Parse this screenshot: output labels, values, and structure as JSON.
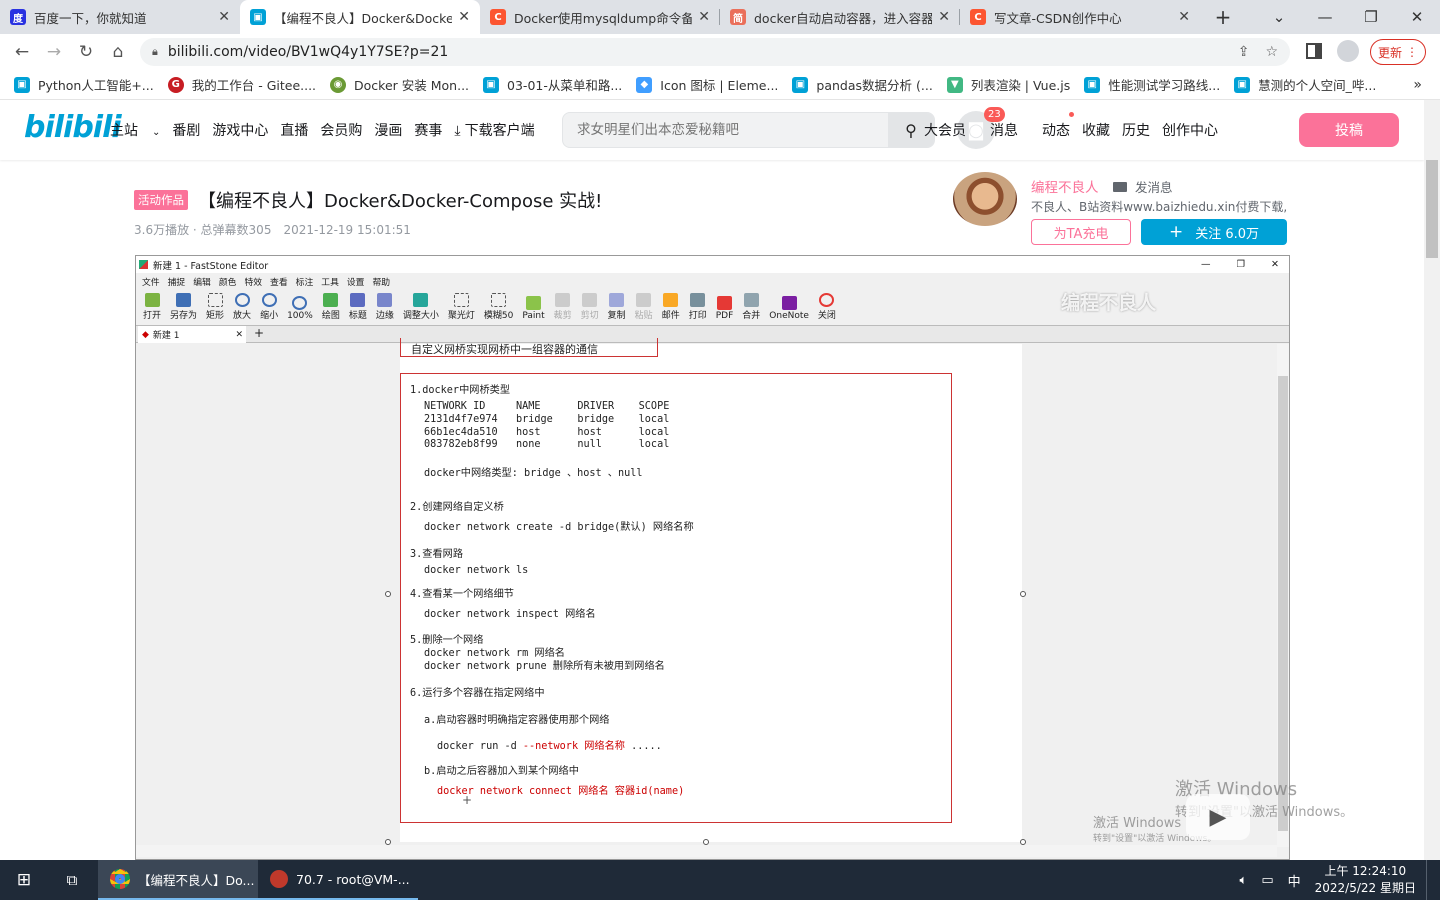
{
  "browser": {
    "tabs": [
      {
        "title": "百度一下，你就知道",
        "icon": "baidu-paw-icon",
        "color": "#2932e1"
      },
      {
        "title": "【编程不良人】Docker&Docker-Compose",
        "icon": "bilibili-tv-icon",
        "color": "#00a1d6"
      },
      {
        "title": "Docker使用mysqldump命令备份",
        "icon": "csdn-c-icon",
        "color": "#fc5531"
      },
      {
        "title": "docker自动启动容器，进入容器",
        "icon": "jianshu-icon",
        "color": "#ea6f5a"
      },
      {
        "title": "写文章-CSDN创作中心",
        "icon": "csdn-c-icon",
        "color": "#fc5531"
      }
    ],
    "new_tab": "+",
    "url": "bilibili.com/video/BV1wQ4y1Y7SE?p=21",
    "update_label": "更新",
    "bookmarks": [
      {
        "label": "Python人工智能+...",
        "color": "#00a1d6"
      },
      {
        "label": "我的工作台 - Gitee....",
        "color": "#c71d23"
      },
      {
        "label": "Docker 安装 Mon...",
        "color": "#6b9a35"
      },
      {
        "label": "03-01-从菜单和路...",
        "color": "#00a1d6"
      },
      {
        "label": "Icon 图标 | Eleme...",
        "color": "#409eff"
      },
      {
        "label": "pandas数据分析 (...",
        "color": "#00a1d6"
      },
      {
        "label": "列表渲染 | Vue.js",
        "color": "#41b883"
      },
      {
        "label": "性能测试学习路线...",
        "color": "#00a1d6"
      },
      {
        "label": "慧测的个人空间_哔...",
        "color": "#00a1d6"
      }
    ]
  },
  "bili": {
    "logo": "bilibili",
    "nav": [
      "主站",
      "番剧",
      "游戏中心",
      "直播",
      "会员购",
      "漫画",
      "赛事",
      "下载客户端"
    ],
    "search_placeholder": "求女明星们出本恋爱秘籍吧",
    "right_nav": [
      "大会员",
      "消息",
      "动态",
      "收藏",
      "历史",
      "创作中心"
    ],
    "msg_badge": "23",
    "upload": "投稿",
    "pink": "#fb7299",
    "blue": "#00a1d6"
  },
  "video": {
    "tag": "活动作品",
    "title": "【编程不良人】Docker&Docker-Compose 实战!",
    "plays": "3.6万播放",
    "danmaku": "总弹幕数305",
    "date": "2021-12-19 15:01:51"
  },
  "uploader": {
    "name": "编程不良人",
    "message": "发消息",
    "desc": "不良人、B站资料www.baizhiedu.xin付费下载,...",
    "charge": "为TA充电",
    "follow": "关注 6.0万"
  },
  "faststone": {
    "title": "新建 1 - FastStone Editor",
    "menu": [
      "文件",
      "捕捉",
      "编辑",
      "颜色",
      "特效",
      "查看",
      "标注",
      "工具",
      "设置",
      "帮助"
    ],
    "toolbar": [
      "打开",
      "另存为",
      "矩形",
      "放大",
      "缩小",
      "100%",
      "绘图",
      "标题",
      "边缘",
      "调整大小",
      "聚光灯",
      "模糊50",
      "Paint",
      "裁剪",
      "剪切",
      "复制",
      "粘贴",
      "邮件",
      "打印",
      "PDF",
      "合并",
      "OneNote",
      "关闭"
    ],
    "doc_tab": "新建 1",
    "watermark": "编程不良人",
    "doc": {
      "top_partial": "自定义网桥实现网桥中一组容器的通信",
      "s1": "1.docker中网桥类型",
      "table_header": "NETWORK ID     NAME      DRIVER    SCOPE",
      "rows": [
        "2131d4f7e974   bridge    bridge    local",
        "66b1ec4da510   host      host      local",
        "083782eb8f99   none      null      local"
      ],
      "types": "docker中网络类型: bridge 、host 、null",
      "s2": "2.创建网络自定义桥",
      "s2c": "docker network create -d bridge(默认) 网络名称",
      "s3": "3.查看网路",
      "s3c": "docker network ls",
      "s4": "4.查看某一个网络细节",
      "s4c": "docker network inspect 网络名",
      "s5": "5.删除一个网络",
      "s5a": "docker network rm 网络名",
      "s5b": "docker network prune 删除所有未被用到网络名",
      "s6": "6.运行多个容器在指定网络中",
      "s6a": "a.启动容器时明确指定容器使用那个网络",
      "s6a_cmd": "docker run -d ",
      "s6a_red": "--network 网络名称",
      "s6a_tail": " .....",
      "s6b": "b.启动之后容器加入到某个网络中",
      "s6b_cmd": "docker network connect 网络名 容器id(name)"
    }
  },
  "activate": {
    "line1": "激活 Windows",
    "line2": "转到\"设置\"以激活 Windows。",
    "line3": "激活 Windows",
    "line4": "转到\"设置\"以激活 Windows。"
  },
  "taskbar": {
    "apps": [
      "【编程不良人】Do...",
      "70.7 - root@VM-..."
    ],
    "ime": "中",
    "time": "上午 12:24:10",
    "date": "2022/5/22 星期日"
  }
}
